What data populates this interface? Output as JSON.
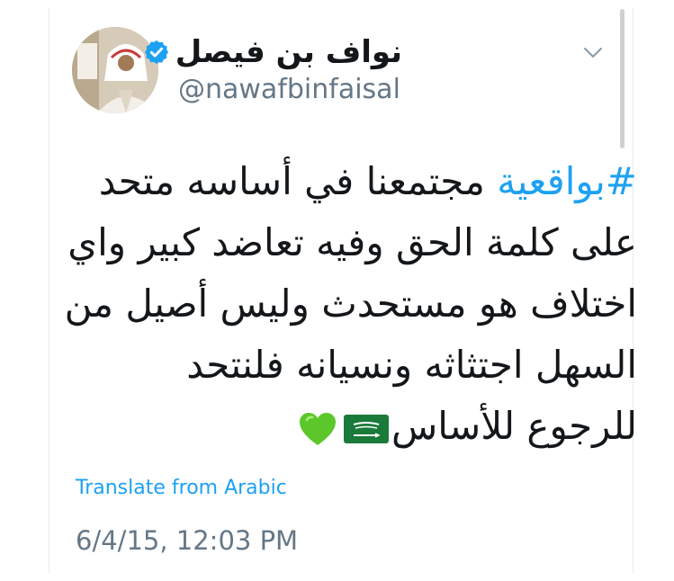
{
  "tweet": {
    "display_name": "نواف بن فيصل",
    "username": "@nawafbinfaisal",
    "hashtag": "#بواقعية",
    "lines": [
      " مجتمعنا في أساسه متحد",
      "على كلمة الحق وفيه تعاضد كبير واي",
      "اختلاف هو مستحدث وليس أصيل من",
      "السهل اجتثاثه ونسيانه فلنتحد",
      "للرجوع للأساس"
    ],
    "flag_text": "SA",
    "translate_label": "Translate from Arabic",
    "timestamp": "6/4/15, 12:03 PM"
  },
  "colors": {
    "accent": "#1da1f2",
    "text": "#14171a",
    "secondary": "#657786",
    "flag_green": "#1a7a3a",
    "heart_green": "#5cc72a"
  },
  "icons": {
    "verified": "verified-badge-icon",
    "menu": "chevron-down-icon",
    "flag": "saudi-flag-icon",
    "heart": "green-heart-icon"
  }
}
